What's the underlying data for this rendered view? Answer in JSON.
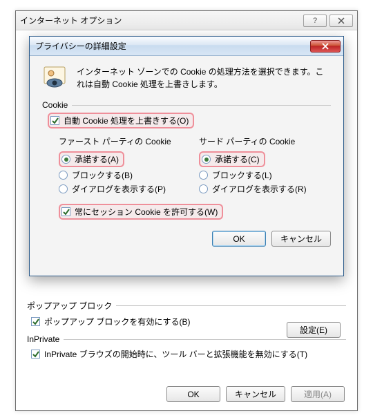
{
  "outer": {
    "title": "インターネット オプション",
    "popup_group": "ポップアップ ブロック",
    "popup_checkbox": "ポップアップ ブロックを有効にする(B)",
    "settings_button": "設定(E)",
    "inprivate_group": "InPrivate",
    "inprivate_checkbox": "InPrivate ブラウズの開始時に、ツール バーと拡張機能を無効にする(T)",
    "ok": "OK",
    "cancel": "キャンセル",
    "apply": "適用(A)"
  },
  "modal": {
    "title": "プライバシーの詳細設定",
    "intro": "インターネット ゾーンでの Cookie の処理方法を選択できます。これは自動 Cookie 処理を上書きします。",
    "cookie_group": "Cookie",
    "override_checkbox": "自動 Cookie 処理を上書きする(O)",
    "first_party_title": "ファースト パーティの Cookie",
    "third_party_title": "サード パーティの Cookie",
    "first": {
      "accept": "承諾する(A)",
      "block": "ブロックする(B)",
      "prompt": "ダイアログを表示する(P)"
    },
    "third": {
      "accept": "承諾する(C)",
      "block": "ブロックする(L)",
      "prompt": "ダイアログを表示する(R)"
    },
    "session_checkbox": "常にセッション Cookie を許可する(W)",
    "ok": "OK",
    "cancel": "キャンセル"
  }
}
